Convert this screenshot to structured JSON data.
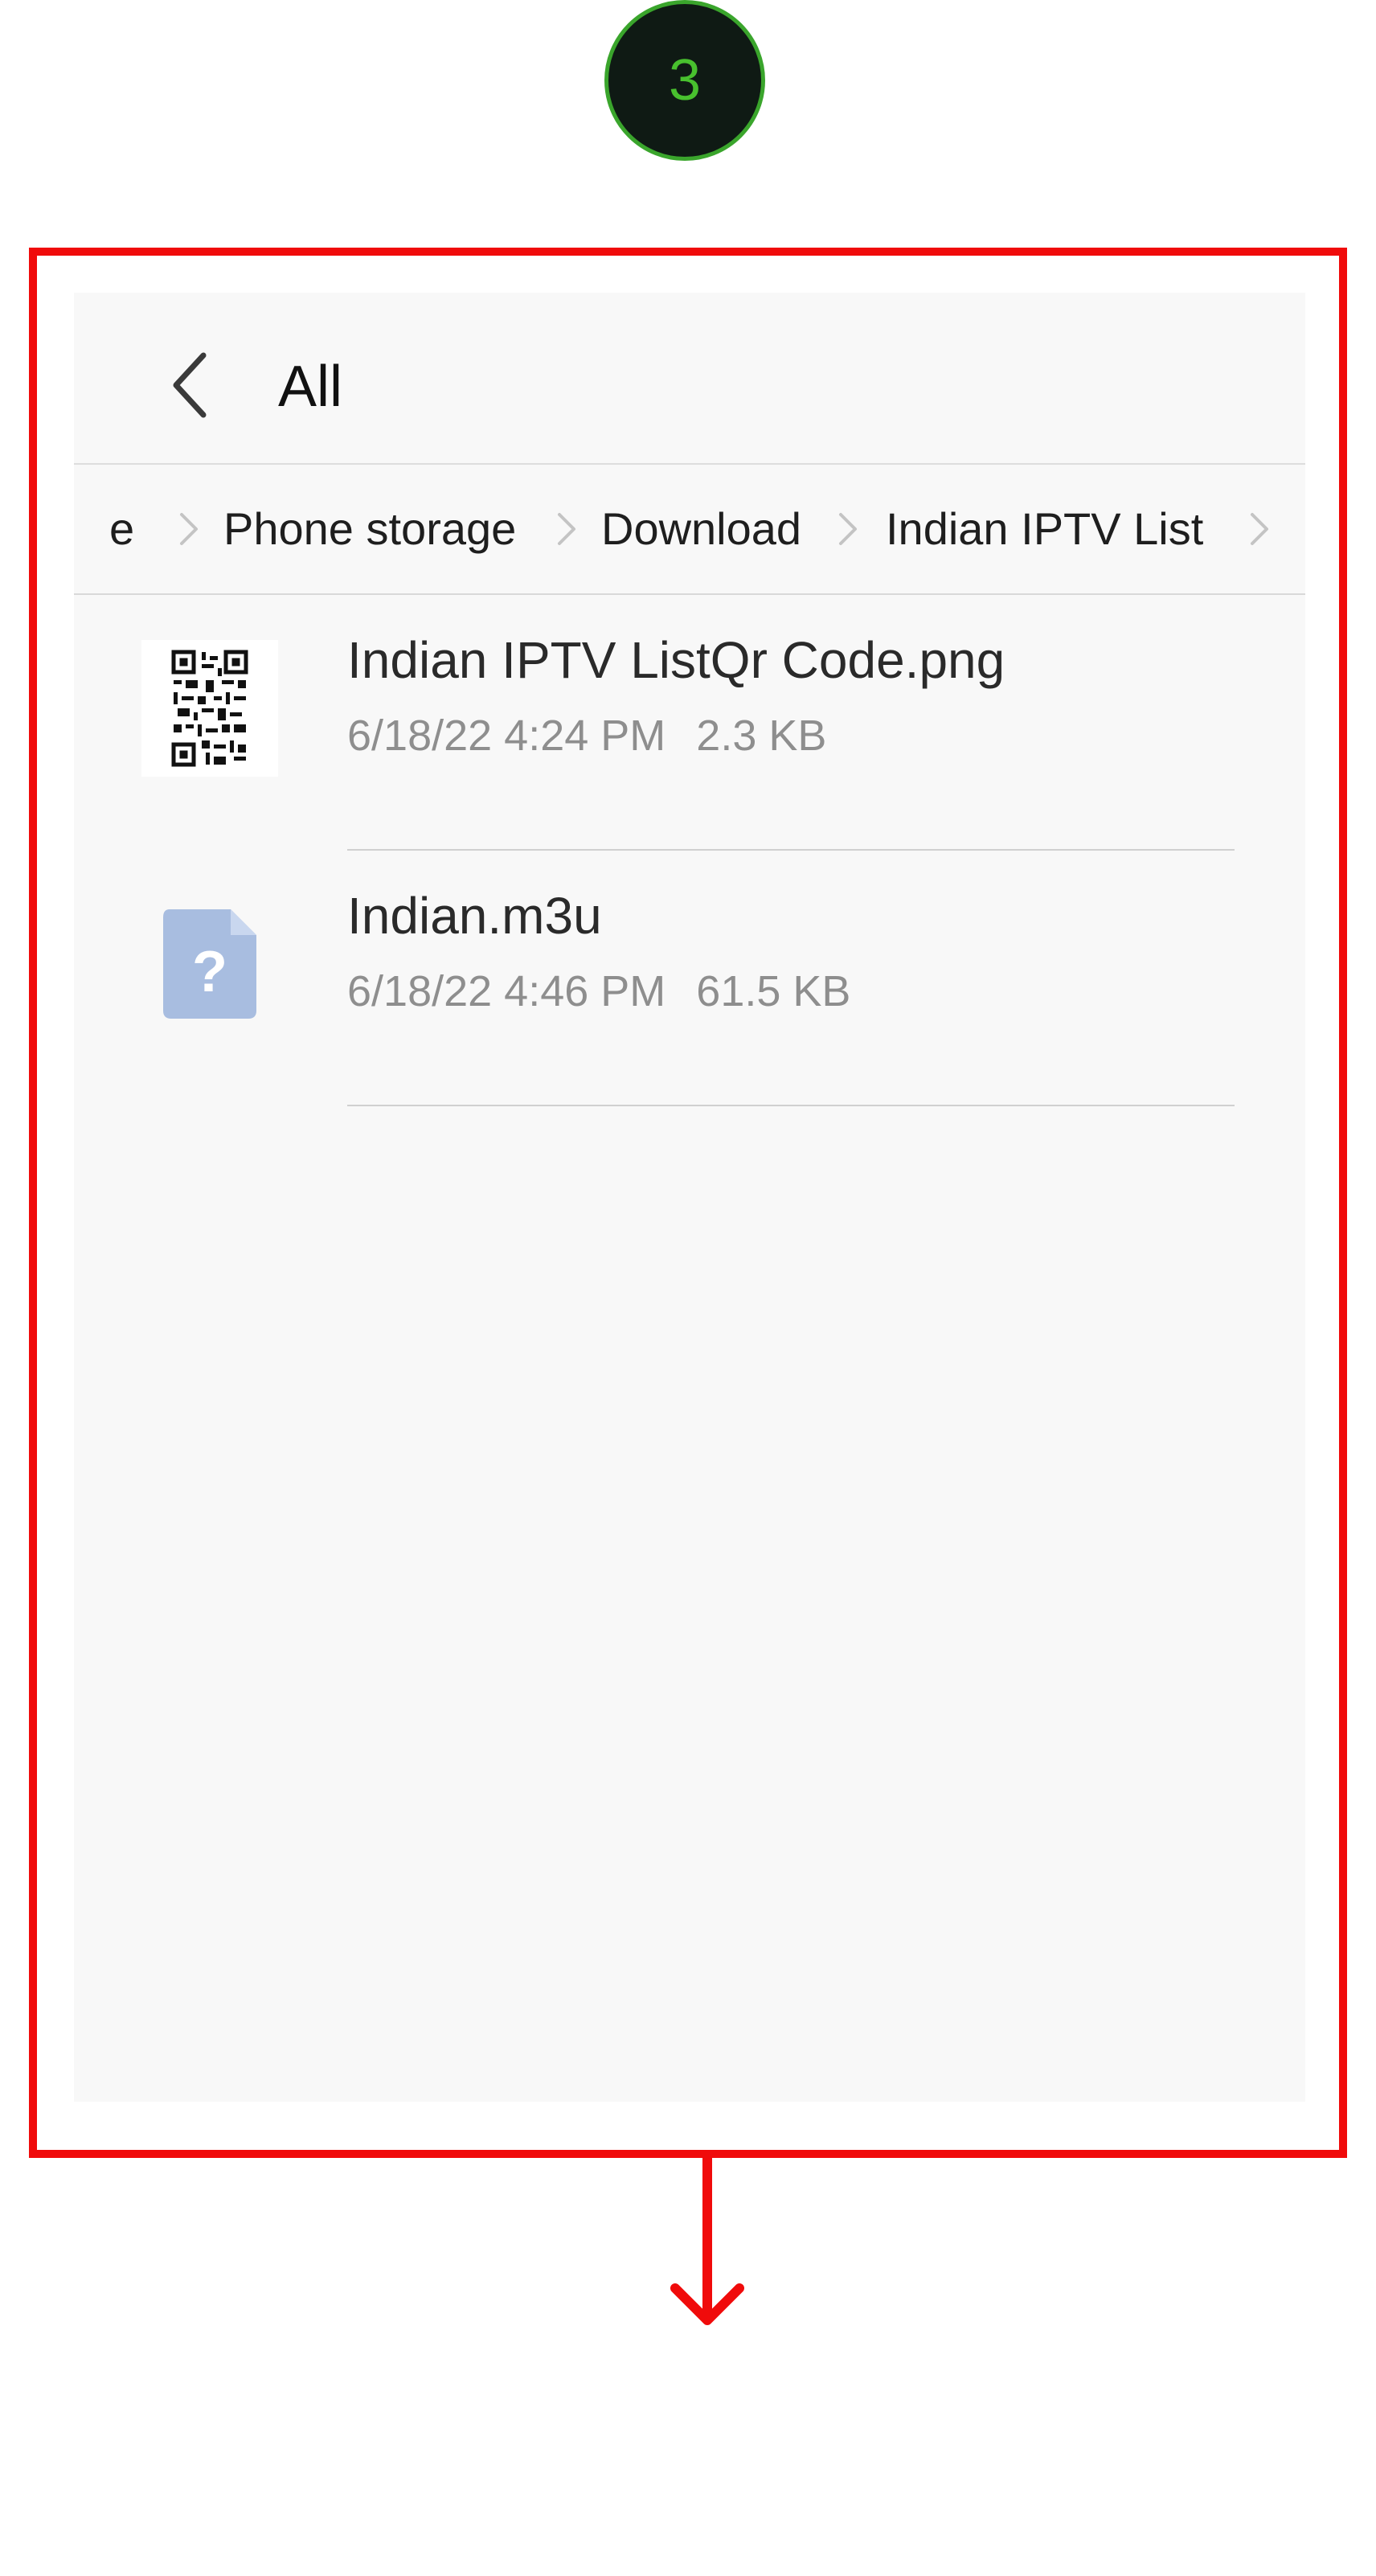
{
  "step": {
    "number": "3"
  },
  "colors": {
    "highlight": "#f00b0b",
    "badge_ring": "#3aa52c",
    "badge_fill": "#0f1a14",
    "unknown_file_icon": "#a8bde0"
  },
  "app_bar": {
    "back_icon": "chevron-left-icon",
    "title": "All"
  },
  "breadcrumb": {
    "items": [
      "e",
      "Phone storage",
      "Download",
      "Indian IPTV List"
    ],
    "separator_icon": "chevron-right-icon"
  },
  "files": [
    {
      "name": "Indian IPTV ListQr Code.png",
      "date": "6/18/22 4:24 PM",
      "size": "2.3 KB",
      "icon": "qr-code-thumbnail"
    },
    {
      "name": "Indian.m3u",
      "date": "6/18/22 4:46 PM",
      "size": "61.5 KB",
      "icon": "unknown-file-icon",
      "icon_glyph": "?"
    }
  ],
  "annotation": {
    "arrow_icon": "arrow-down-icon"
  }
}
